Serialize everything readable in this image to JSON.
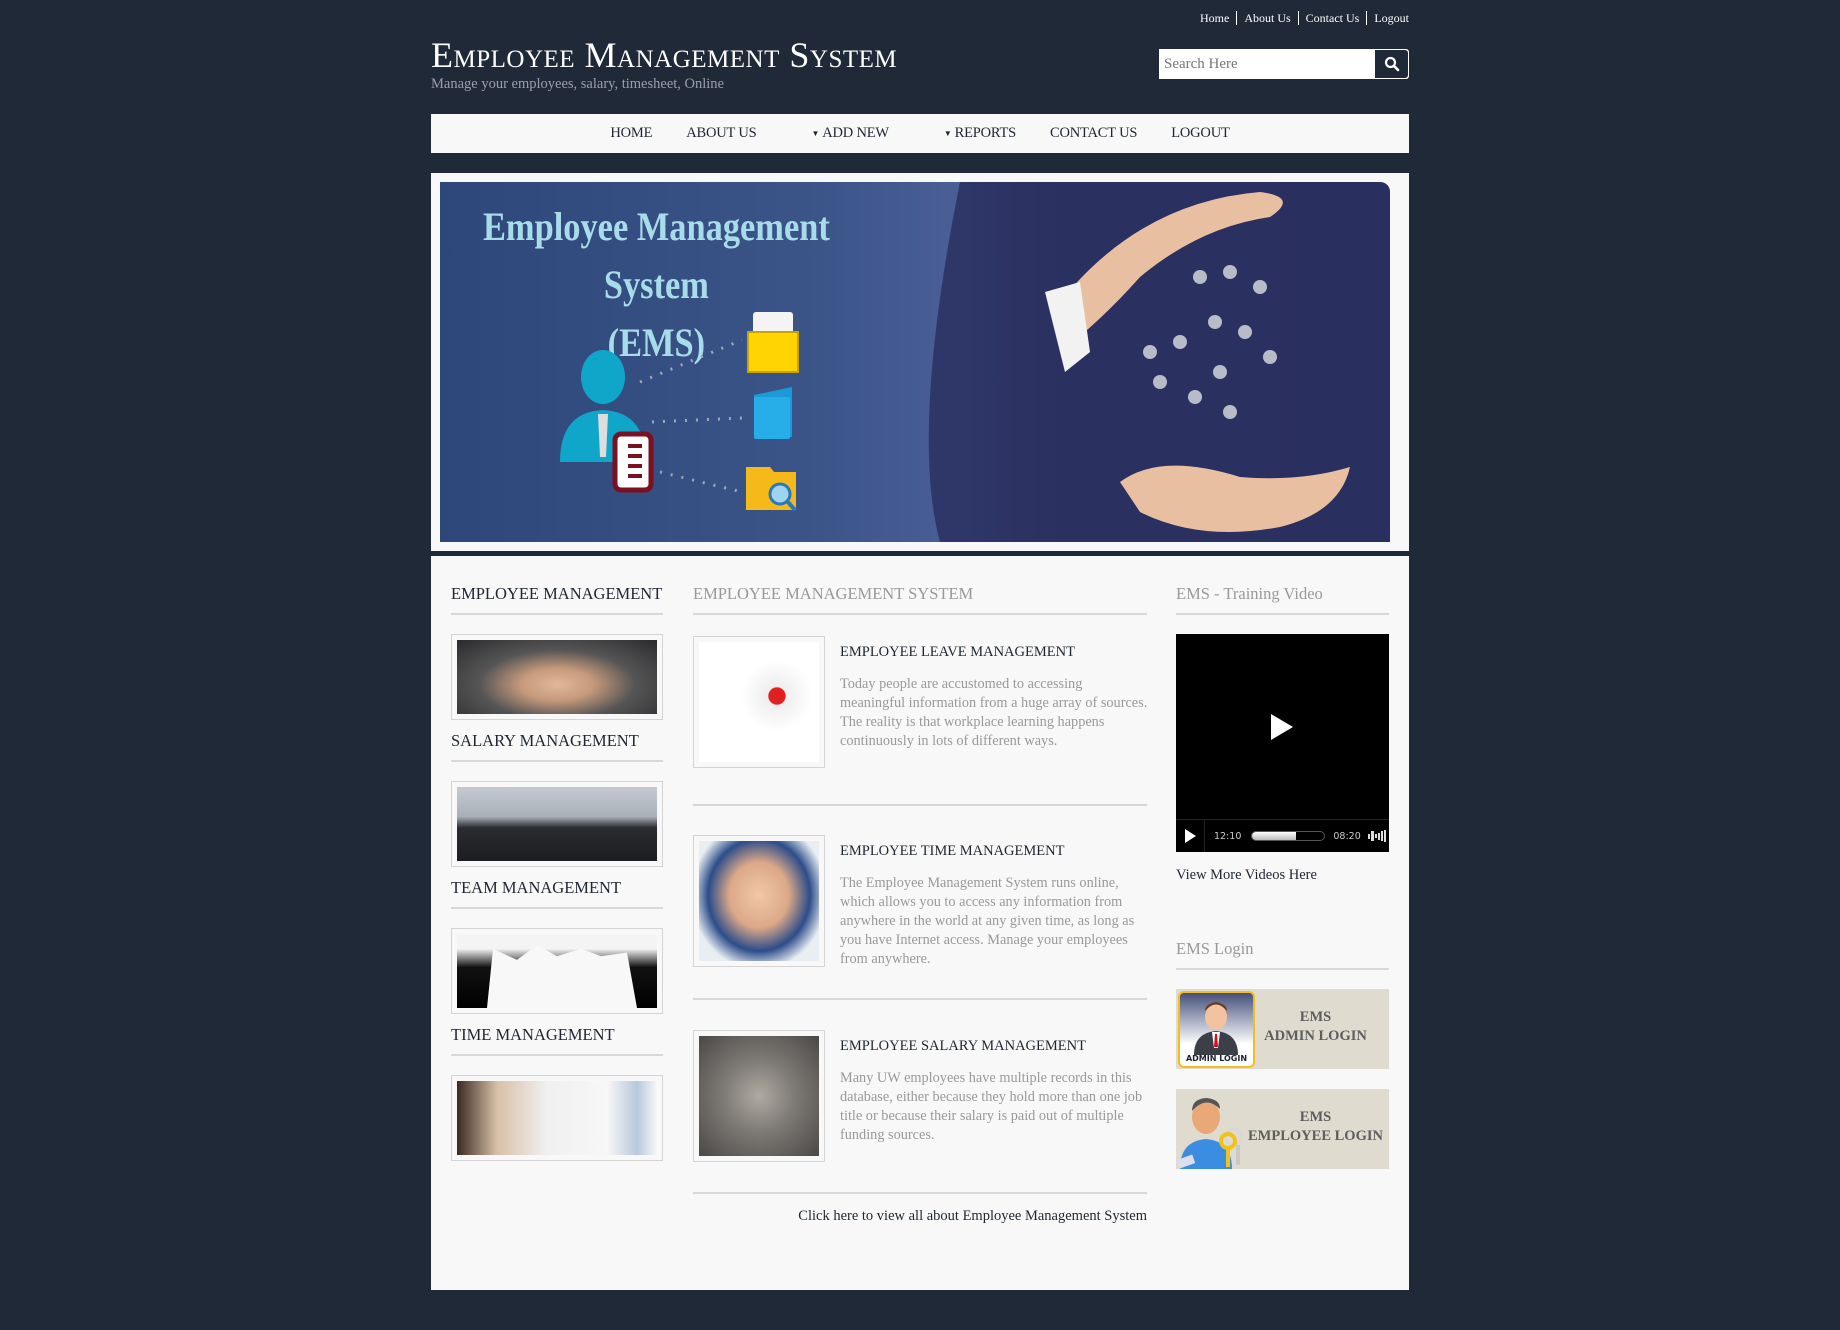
{
  "top_links": [
    "Home",
    "About Us",
    "Contact Us",
    "Logout"
  ],
  "header": {
    "title": "Employee Management System",
    "subtitle": "Manage your employees, salary, timesheet, Online"
  },
  "search": {
    "placeholder": "Search Here",
    "value": "",
    "button_icon": "search-icon"
  },
  "nav": {
    "items": [
      {
        "label": "HOME",
        "dropdown": false
      },
      {
        "label": "ABOUT US",
        "dropdown": false
      },
      {
        "label": "ADD NEW",
        "dropdown": true
      },
      {
        "label": "REPORTS",
        "dropdown": true
      },
      {
        "label": "CONTACT US",
        "dropdown": false
      },
      {
        "label": "LOGOUT",
        "dropdown": false
      }
    ]
  },
  "banner": {
    "title_line1": "Employee Management System",
    "title_line2": "(EMS)"
  },
  "left_column": {
    "sections": [
      {
        "title": "EMPLOYEE MANAGEMENT",
        "image": "hands-stacked-photo"
      },
      {
        "title": "SALARY MANAGEMENT",
        "image": "idea-businessmen-photo"
      },
      {
        "title": "TEAM MANAGEMENT",
        "image": "team-silhouette-photo"
      },
      {
        "title": "TIME MANAGEMENT",
        "image": "presentation-meeting-photo"
      }
    ]
  },
  "middle_column": {
    "title": "EMPLOYEE MANAGEMENT SYSTEM",
    "articles": [
      {
        "title": "EMPLOYEE LEAVE MANAGEMENT",
        "body": "Today people are accustomed to accessing meaningful information from a huge array of sources. The reality is that workplace learning happens continuously in lots of different ways.",
        "image": "people-chart-illustration"
      },
      {
        "title": "EMPLOYEE TIME MANAGEMENT",
        "body": "The Employee Management System runs online, which allows you to access any information from anywhere in the world at any given time, as long as you have Internet access. Manage your employees from anywhere.",
        "image": "hands-together-photo"
      },
      {
        "title": "EMPLOYEE SALARY MANAGEMENT",
        "body": "Many UW employees have multiple records in this database, either because they hold more than one job title or because their salary is paid out of multiple funding sources.",
        "image": "money-handover-photo"
      }
    ],
    "view_all_link": "Click here to view all about Employee Management System"
  },
  "right_column": {
    "video_title": "EMS - Training Video",
    "video": {
      "current_time": "12:10",
      "duration": "08:20",
      "progress_percent": 60
    },
    "more_videos_link": "View More Videos Here",
    "login_title": "EMS Login",
    "admin_login": {
      "line1": "EMS",
      "line2": "ADMIN LOGIN",
      "icon_label": "ADMIN LOGIN"
    },
    "employee_login": {
      "line1": "EMS",
      "line2": "EMPLOYEE LOGIN"
    }
  }
}
